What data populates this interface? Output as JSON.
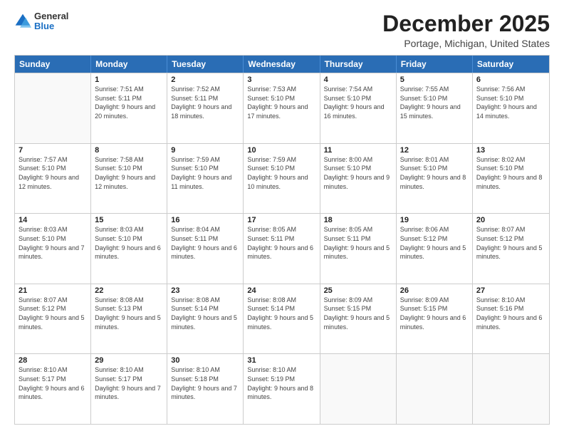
{
  "header": {
    "logo": {
      "general": "General",
      "blue": "Blue"
    },
    "month_title": "December 2025",
    "location": "Portage, Michigan, United States"
  },
  "calendar": {
    "days_of_week": [
      "Sunday",
      "Monday",
      "Tuesday",
      "Wednesday",
      "Thursday",
      "Friday",
      "Saturday"
    ],
    "weeks": [
      [
        {
          "day": "",
          "empty": true
        },
        {
          "day": "1",
          "sunrise": "7:51 AM",
          "sunset": "5:11 PM",
          "daylight": "9 hours and 20 minutes."
        },
        {
          "day": "2",
          "sunrise": "7:52 AM",
          "sunset": "5:11 PM",
          "daylight": "9 hours and 18 minutes."
        },
        {
          "day": "3",
          "sunrise": "7:53 AM",
          "sunset": "5:10 PM",
          "daylight": "9 hours and 17 minutes."
        },
        {
          "day": "4",
          "sunrise": "7:54 AM",
          "sunset": "5:10 PM",
          "daylight": "9 hours and 16 minutes."
        },
        {
          "day": "5",
          "sunrise": "7:55 AM",
          "sunset": "5:10 PM",
          "daylight": "9 hours and 15 minutes."
        },
        {
          "day": "6",
          "sunrise": "7:56 AM",
          "sunset": "5:10 PM",
          "daylight": "9 hours and 14 minutes."
        }
      ],
      [
        {
          "day": "7",
          "sunrise": "7:57 AM",
          "sunset": "5:10 PM",
          "daylight": "9 hours and 12 minutes."
        },
        {
          "day": "8",
          "sunrise": "7:58 AM",
          "sunset": "5:10 PM",
          "daylight": "9 hours and 12 minutes."
        },
        {
          "day": "9",
          "sunrise": "7:59 AM",
          "sunset": "5:10 PM",
          "daylight": "9 hours and 11 minutes."
        },
        {
          "day": "10",
          "sunrise": "7:59 AM",
          "sunset": "5:10 PM",
          "daylight": "9 hours and 10 minutes."
        },
        {
          "day": "11",
          "sunrise": "8:00 AM",
          "sunset": "5:10 PM",
          "daylight": "9 hours and 9 minutes."
        },
        {
          "day": "12",
          "sunrise": "8:01 AM",
          "sunset": "5:10 PM",
          "daylight": "9 hours and 8 minutes."
        },
        {
          "day": "13",
          "sunrise": "8:02 AM",
          "sunset": "5:10 PM",
          "daylight": "9 hours and 8 minutes."
        }
      ],
      [
        {
          "day": "14",
          "sunrise": "8:03 AM",
          "sunset": "5:10 PM",
          "daylight": "9 hours and 7 minutes."
        },
        {
          "day": "15",
          "sunrise": "8:03 AM",
          "sunset": "5:10 PM",
          "daylight": "9 hours and 6 minutes."
        },
        {
          "day": "16",
          "sunrise": "8:04 AM",
          "sunset": "5:11 PM",
          "daylight": "9 hours and 6 minutes."
        },
        {
          "day": "17",
          "sunrise": "8:05 AM",
          "sunset": "5:11 PM",
          "daylight": "9 hours and 6 minutes."
        },
        {
          "day": "18",
          "sunrise": "8:05 AM",
          "sunset": "5:11 PM",
          "daylight": "9 hours and 5 minutes."
        },
        {
          "day": "19",
          "sunrise": "8:06 AM",
          "sunset": "5:12 PM",
          "daylight": "9 hours and 5 minutes."
        },
        {
          "day": "20",
          "sunrise": "8:07 AM",
          "sunset": "5:12 PM",
          "daylight": "9 hours and 5 minutes."
        }
      ],
      [
        {
          "day": "21",
          "sunrise": "8:07 AM",
          "sunset": "5:12 PM",
          "daylight": "9 hours and 5 minutes."
        },
        {
          "day": "22",
          "sunrise": "8:08 AM",
          "sunset": "5:13 PM",
          "daylight": "9 hours and 5 minutes."
        },
        {
          "day": "23",
          "sunrise": "8:08 AM",
          "sunset": "5:14 PM",
          "daylight": "9 hours and 5 minutes."
        },
        {
          "day": "24",
          "sunrise": "8:08 AM",
          "sunset": "5:14 PM",
          "daylight": "9 hours and 5 minutes."
        },
        {
          "day": "25",
          "sunrise": "8:09 AM",
          "sunset": "5:15 PM",
          "daylight": "9 hours and 5 minutes."
        },
        {
          "day": "26",
          "sunrise": "8:09 AM",
          "sunset": "5:15 PM",
          "daylight": "9 hours and 6 minutes."
        },
        {
          "day": "27",
          "sunrise": "8:10 AM",
          "sunset": "5:16 PM",
          "daylight": "9 hours and 6 minutes."
        }
      ],
      [
        {
          "day": "28",
          "sunrise": "8:10 AM",
          "sunset": "5:17 PM",
          "daylight": "9 hours and 6 minutes."
        },
        {
          "day": "29",
          "sunrise": "8:10 AM",
          "sunset": "5:17 PM",
          "daylight": "9 hours and 7 minutes."
        },
        {
          "day": "30",
          "sunrise": "8:10 AM",
          "sunset": "5:18 PM",
          "daylight": "9 hours and 7 minutes."
        },
        {
          "day": "31",
          "sunrise": "8:10 AM",
          "sunset": "5:19 PM",
          "daylight": "9 hours and 8 minutes."
        },
        {
          "day": "",
          "empty": true
        },
        {
          "day": "",
          "empty": true
        },
        {
          "day": "",
          "empty": true
        }
      ]
    ]
  }
}
